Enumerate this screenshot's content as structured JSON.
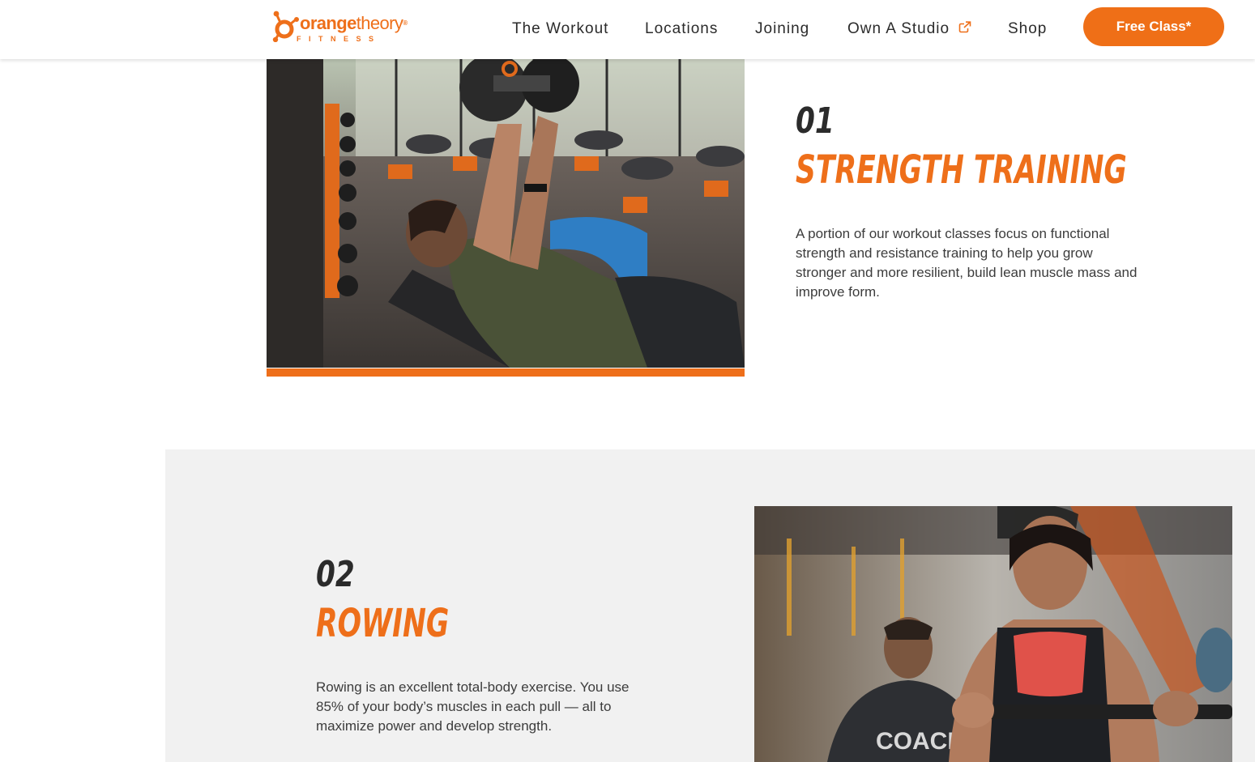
{
  "brand": {
    "logo_word_bold": "orange",
    "logo_word_rest": "theory",
    "logo_sub": "FITNESS",
    "accent_color": "#ee6f1a"
  },
  "nav": {
    "items": [
      {
        "label": "The Workout"
      },
      {
        "label": "Locations"
      },
      {
        "label": "Joining"
      },
      {
        "label": "Own A Studio",
        "external": true
      },
      {
        "label": "Shop"
      }
    ],
    "cta_label": "Free Class*"
  },
  "sections": [
    {
      "number": "01",
      "title": "STRENGTH TRAINING",
      "body": "A portion of our workout classes focus on functional strength and resistance training to help you grow stronger and more resilient, build lean muscle mass and improve form.",
      "image_alt": "Man performing dumbbell press on a bench in a group fitness class"
    },
    {
      "number": "02",
      "title": "ROWING",
      "body": "Rowing is an excellent total-body exercise. You use 85% of your body’s muscles in each pull — all to maximize power and develop strength.",
      "image_alt": "Woman rowing on a rowing machine with a coach behind her"
    }
  ]
}
